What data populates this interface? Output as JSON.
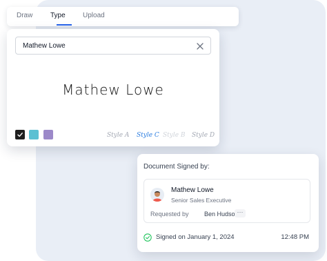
{
  "tabs": [
    {
      "label": "Draw",
      "active": false
    },
    {
      "label": "Type",
      "active": true
    },
    {
      "label": "Upload",
      "active": false
    }
  ],
  "signature": {
    "name_value": "Mathew Lowe",
    "preview_text": "Mathew Lowe",
    "colors": [
      "#1f1f1f",
      "#5bc0d3",
      "#9c89c9"
    ],
    "selected_color": "#1f1f1f",
    "styles": [
      "Style A",
      "Style C",
      "Style B",
      "Style D"
    ],
    "selected_style": "Style C"
  },
  "document": {
    "title": "Document Signed by:",
    "signer_name": "Mathew Lowe",
    "signer_role": "Senior Sales Executive",
    "requested_label": "Requested by",
    "requested_by": "Ben Hudson",
    "more_label": "···",
    "signed_on": "Signed on January 1, 2024",
    "signed_time": "12:48 PM"
  },
  "icons": {
    "clear": "close-icon",
    "check": "check-circle-icon",
    "avatar": "avatar"
  },
  "accent": "#2563eb",
  "success": "#22c55e"
}
